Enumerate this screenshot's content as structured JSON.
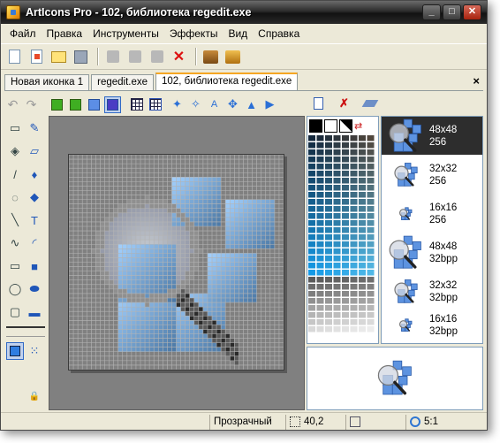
{
  "window": {
    "title": "ArtIcons Pro - 102, библиотека regedit.exe",
    "controls": {
      "minimize": "_",
      "maximize": "□",
      "close": "✕"
    }
  },
  "menu": [
    "Файл",
    "Правка",
    "Инструменты",
    "Эффекты",
    "Вид",
    "Справка"
  ],
  "toolbar_icons": [
    "new-file-icon",
    "new-color-icon",
    "open-folder-icon",
    "save-icon",
    "cut-icon",
    "copy-icon",
    "paste-icon",
    "delete-icon",
    "extract-icon",
    "library-icon"
  ],
  "tabs": [
    {
      "label": "Новая иконка 1"
    },
    {
      "label": "regedit.exe"
    },
    {
      "label": "102, библиотека regedit.exe"
    }
  ],
  "tab_close_label": "×",
  "sizes": [
    {
      "dim": "48x48",
      "depth": "256"
    },
    {
      "dim": "32x32",
      "depth": "256"
    },
    {
      "dim": "16x16",
      "depth": "256"
    },
    {
      "dim": "48x48",
      "depth": "32bpp"
    },
    {
      "dim": "32x32",
      "depth": "32bpp"
    },
    {
      "dim": "16x16",
      "depth": "32bpp"
    }
  ],
  "colors": {
    "accent": "#316ac5",
    "selected_size_bg": "#2d2d2d",
    "title_bar": "#1a1a1a"
  },
  "status": {
    "transparency": "Прозрачный",
    "coords": "40,2",
    "zoom": "5:1"
  }
}
